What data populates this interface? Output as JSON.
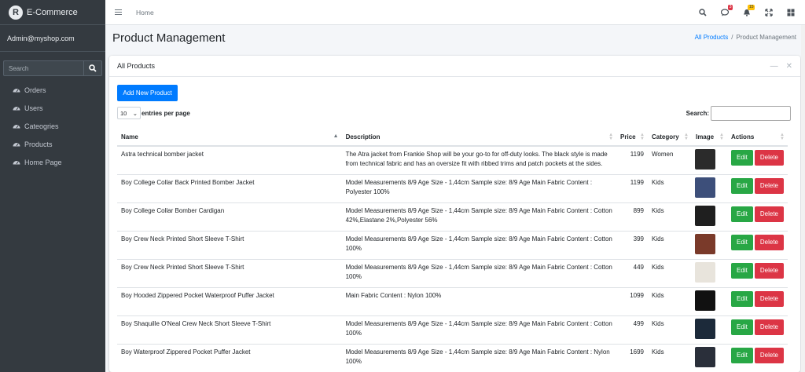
{
  "brand": {
    "name": "E-Commerce",
    "logo_letter": "R"
  },
  "user": {
    "email": "Admin@myshop.com"
  },
  "sidebar_search": {
    "placeholder": "Search"
  },
  "nav": [
    {
      "label": "Orders",
      "icon": "dashboard-icon"
    },
    {
      "label": "Users",
      "icon": "dashboard-icon"
    },
    {
      "label": "Cateogries",
      "icon": "dashboard-icon"
    },
    {
      "label": "Products",
      "icon": "dashboard-icon"
    },
    {
      "label": "Home Page",
      "icon": "dashboard-icon"
    }
  ],
  "topbar": {
    "home": "Home",
    "messages_badge": "3",
    "notifications_badge": "15"
  },
  "header": {
    "title": "Product Management",
    "breadcrumb_link": "All Products",
    "breadcrumb_sep": "/",
    "breadcrumb_current": "Product Management"
  },
  "card": {
    "title": "All Products",
    "add_button": "Add New Product",
    "length_value": "10",
    "length_label": "entries per page",
    "search_label": "Search:"
  },
  "table": {
    "columns": [
      "Name",
      "Description",
      "Price",
      "Category",
      "Image",
      "Actions"
    ],
    "edit_label": "Edit",
    "delete_label": "Delete",
    "rows": [
      {
        "name": "Astra technical bomber jacket",
        "description": "The Atra jacket from Frankie Shop will be your go-to for off-duty looks. The black style is made from technical fabric and has an oversize fit with ribbed trims and patch pockets at the sides.",
        "price": "1199",
        "category": "Women",
        "image_color": "#2b2b2b"
      },
      {
        "name": "Boy College Collar Back Printed Bomber Jacket",
        "description": "Model Measurements 8/9 Age Size - 1,44cm Sample size: 8/9 Age Main Fabric Content : Polyester 100%",
        "price": "1199",
        "category": "Kids",
        "image_color": "#3d4f7a"
      },
      {
        "name": "Boy College Collar Bomber Cardigan",
        "description": "Model Measurements 8/9 Age Size - 1,44cm Sample size: 8/9 Age Main Fabric Content : Cotton 42%,Elastane 2%,Polyester 56%",
        "price": "899",
        "category": "Kids",
        "image_color": "#1f1f1f"
      },
      {
        "name": "Boy Crew Neck Printed Short Sleeve T-Shirt",
        "description": "Model Measurements 8/9 Age Size - 1,44cm Sample size: 8/9 Age Main Fabric Content : Cotton 100%",
        "price": "399",
        "category": "Kids",
        "image_color": "#7a3a2a"
      },
      {
        "name": "Boy Crew Neck Printed Short Sleeve T-Shirt",
        "description": "Model Measurements 8/9 Age Size - 1,44cm Sample size: 8/9 Age Main Fabric Content : Cotton 100%",
        "price": "449",
        "category": "Kids",
        "image_color": "#e8e4dc"
      },
      {
        "name": "Boy Hooded Zippered Pocket Waterproof Puffer Jacket",
        "description": "Main Fabric Content : Nylon 100%",
        "price": "1099",
        "category": "Kids",
        "image_color": "#111111"
      },
      {
        "name": "Boy Shaquille O'Neal Crew Neck Short Sleeve T-Shirt",
        "description": "Model Measurements 8/9 Age Size - 1,44cm Sample size: 8/9 Age Main Fabric Content : Cotton 100%",
        "price": "499",
        "category": "Kids",
        "image_color": "#1c2a3a"
      },
      {
        "name": "Boy Waterproof Zippered Pocket Puffer Jacket",
        "description": "Model Measurements 8/9 Age Size - 1,44cm Sample size: 8/9 Age Main Fabric Content : Nylon 100%",
        "price": "1699",
        "category": "Kids",
        "image_color": "#2a2f3a"
      }
    ]
  },
  "colors": {
    "primary": "#007bff",
    "success": "#28a745",
    "danger": "#dc3545",
    "sidebar": "#343a40"
  }
}
